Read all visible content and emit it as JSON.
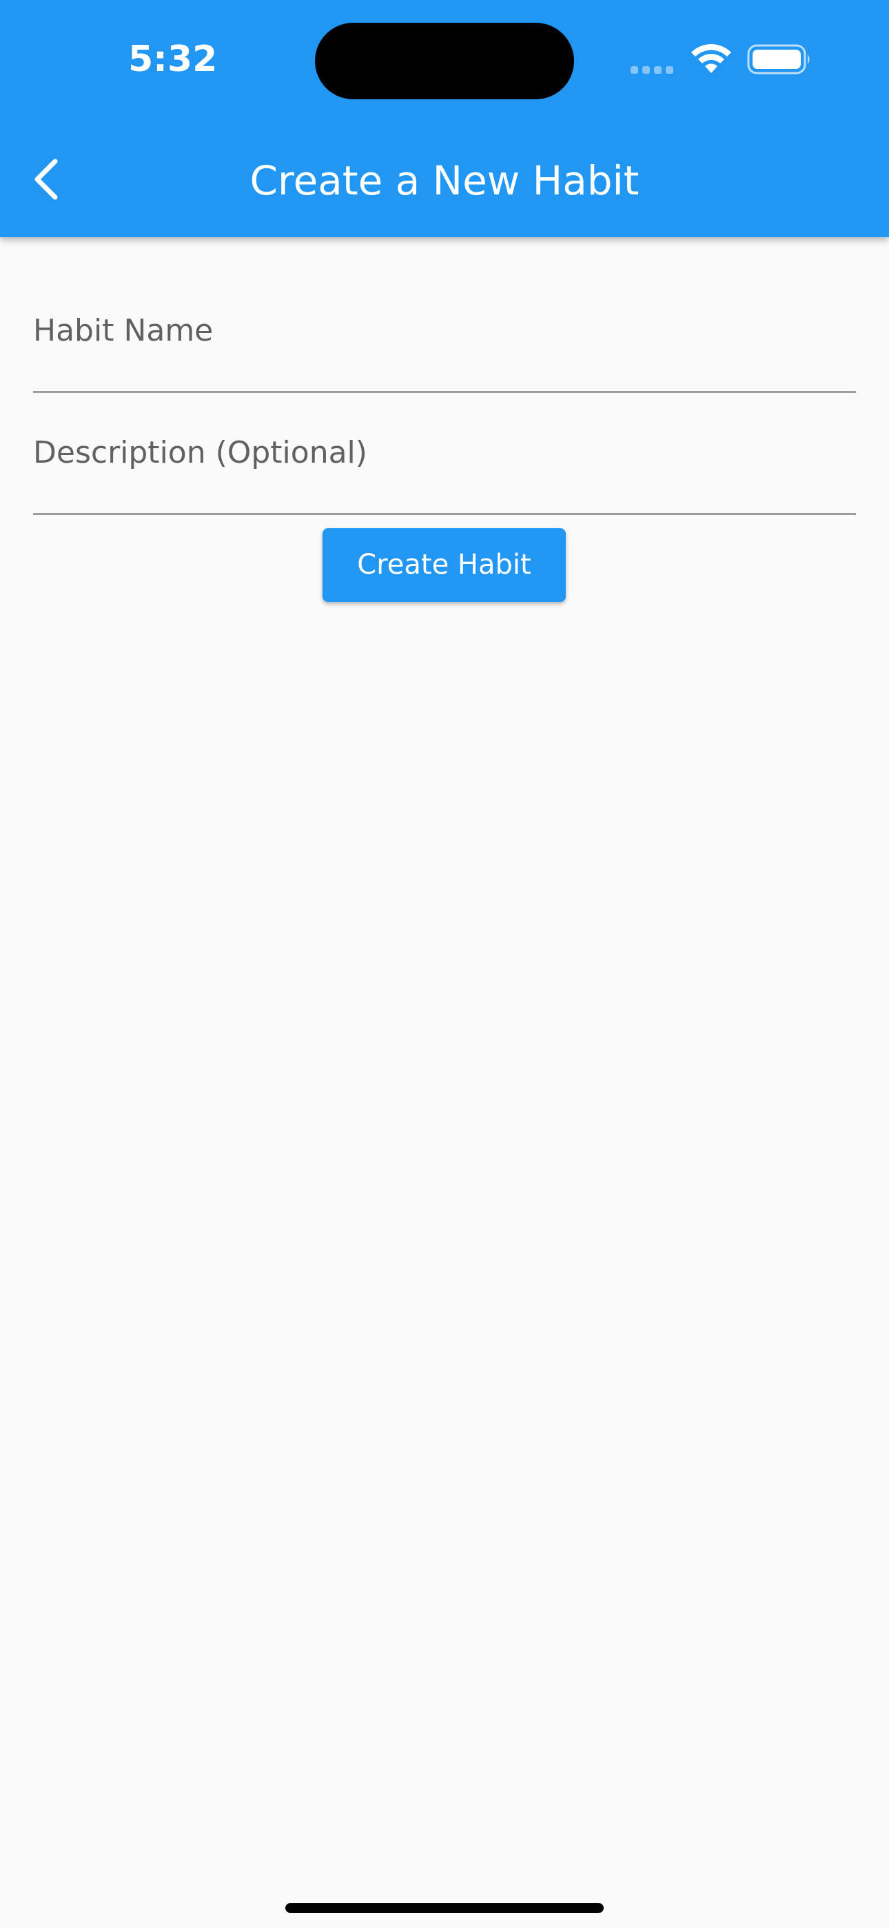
{
  "status_bar": {
    "time": "5:32"
  },
  "app_bar": {
    "title": "Create a New Habit",
    "back_icon": "chevron-left-icon",
    "background_color": "#2196f3"
  },
  "form": {
    "habit_name": {
      "label": "Habit Name",
      "value": ""
    },
    "description": {
      "label": "Description (Optional)",
      "value": ""
    },
    "submit_label": "Create Habit"
  },
  "colors": {
    "accent": "#2196f3",
    "background": "#fafafa",
    "label": "#616161",
    "underline": "#9e9e9e"
  }
}
